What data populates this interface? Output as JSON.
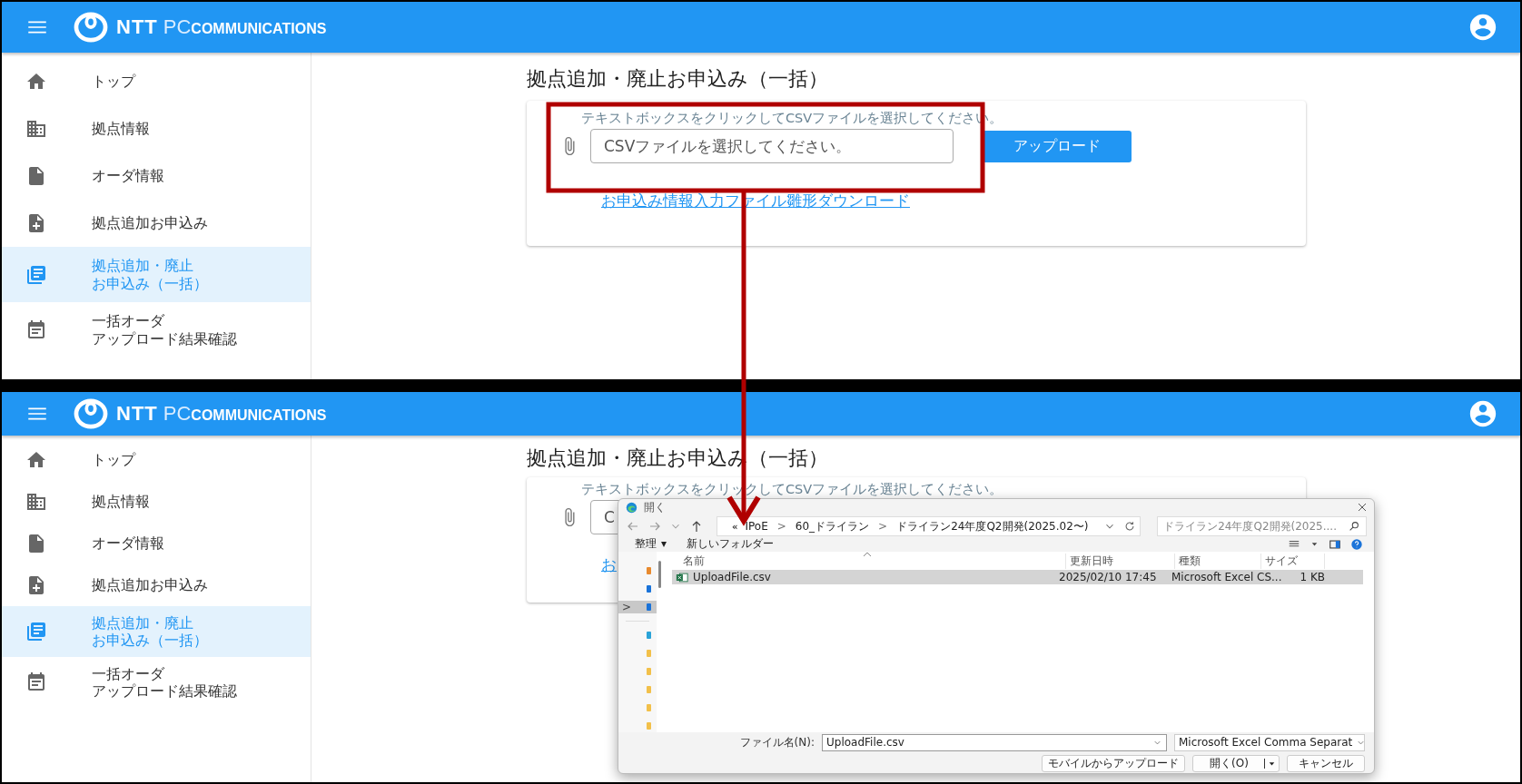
{
  "panels": [
    {
      "header": {
        "logo": [
          "NTT",
          "PC",
          "COMMUNICATIONS"
        ]
      },
      "sidebar": [
        {
          "kind": "home",
          "lines": [
            "トップ"
          ],
          "selected": false
        },
        {
          "kind": "building",
          "lines": [
            "拠点情報"
          ],
          "selected": false
        },
        {
          "kind": "file",
          "lines": [
            "オーダ情報"
          ],
          "selected": false
        },
        {
          "kind": "file-plus",
          "lines": [
            "拠点追加お申込み"
          ],
          "selected": false
        },
        {
          "kind": "books",
          "lines": [
            "拠点追加・廃止",
            "お申込み（一括）"
          ],
          "selected": true
        },
        {
          "kind": "calendar",
          "lines": [
            "一括オーダ",
            "アップロード結果確認"
          ],
          "selected": false
        }
      ],
      "title": "拠点追加・廃止お申込み（一括）",
      "card": {
        "hint": "テキストボックスをクリックしてCSVファイルを選択してください。",
        "field_placeholder": "CSVファイルを選択してください。",
        "upload_button": "アップロード",
        "link": "お申込み情報入力ファイル雛形ダウンロード"
      }
    },
    {
      "header": {
        "logo": [
          "NTT",
          "PC",
          "COMMUNICATIONS"
        ]
      },
      "sidebar": [
        {
          "kind": "home",
          "lines": [
            "トップ"
          ],
          "selected": false
        },
        {
          "kind": "building",
          "lines": [
            "拠点情報"
          ],
          "selected": false
        },
        {
          "kind": "file",
          "lines": [
            "オーダ情報"
          ],
          "selected": false
        },
        {
          "kind": "file-plus",
          "lines": [
            "拠点追加お申込み"
          ],
          "selected": false
        },
        {
          "kind": "books",
          "lines": [
            "拠点追加・廃止",
            "お申込み（一括）"
          ],
          "selected": true
        },
        {
          "kind": "calendar",
          "lines": [
            "一括オーダ",
            "アップロード結果確認"
          ],
          "selected": false
        }
      ],
      "title": "拠点追加・廃止お申込み（一括）",
      "card": {
        "hint": "テキストボックスをクリックしてCSVファイルを選択してください。",
        "field_placeholder": "C",
        "link": "お"
      },
      "dialog": {
        "title": "開く",
        "address": [
          {
            "kind": "overflow",
            "text": "«"
          },
          {
            "kind": "folder",
            "text": "IPoE"
          },
          {
            "kind": "separator",
            "text": ">"
          },
          {
            "kind": "folder",
            "text": "60_ドライラン"
          },
          {
            "kind": "separator",
            "text": ">"
          },
          {
            "kind": "folder",
            "text": "ドライラン24年度Q2開発(2025.02〜)"
          }
        ],
        "search_placeholder": "ドライラン24年度Q2開発(2025....",
        "toolbar": [
          {
            "label": "整理",
            "caret": "▾"
          },
          {
            "label": "新しいフォルダー"
          }
        ],
        "nav_pane": [
          {
            "kind": "home",
            "selected": false
          },
          {
            "kind": "cloud",
            "selected": false
          },
          {
            "kind": "pc",
            "expander": ">",
            "selected": true
          },
          {
            "kind": "desktop",
            "selected": false
          },
          {
            "kind": "folder",
            "selected": false
          },
          {
            "kind": "folder",
            "selected": false
          },
          {
            "kind": "folder",
            "selected": false
          },
          {
            "kind": "folder",
            "selected": false
          },
          {
            "kind": "folder",
            "selected": false
          }
        ],
        "columns": [
          "名前",
          "更新日時",
          "種類",
          "サイズ"
        ],
        "files": [
          {
            "name": "UploadFile.csv",
            "modified": "2025/02/10 17:45",
            "type": "Microsoft Excel CS...",
            "size": "1 KB",
            "selected": true
          }
        ],
        "filename_label": "ファイル名(N):",
        "filename": "UploadFile.csv",
        "filetype": "Microsoft Excel Comma Separat",
        "buttons": [
          {
            "kind": "plain",
            "label": "モバイルからアップロード"
          },
          {
            "kind": "split",
            "label": "開く(O)"
          },
          {
            "kind": "plain",
            "label": "キャンセル"
          }
        ]
      }
    }
  ]
}
